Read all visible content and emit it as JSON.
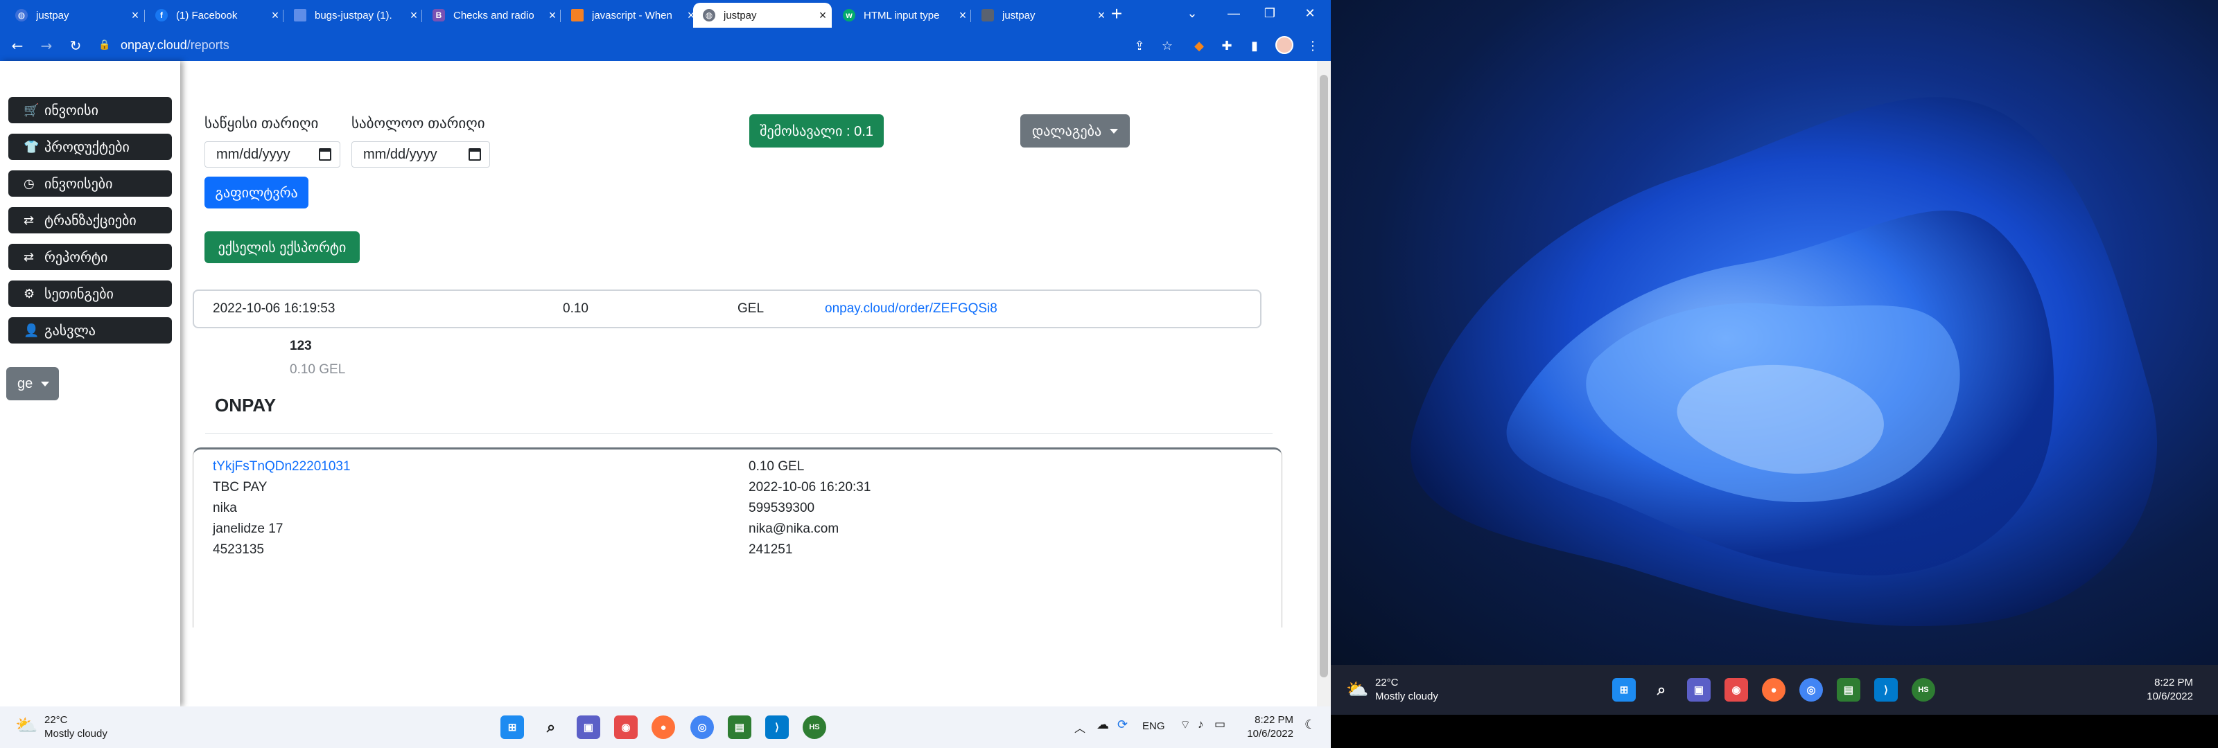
{
  "browser": {
    "tabs": [
      {
        "title": "justpay",
        "favicon": "globe-icon",
        "active": false
      },
      {
        "title": "(1) Facebook",
        "favicon": "facebook-icon",
        "active": false
      },
      {
        "title": "bugs-justpay (1).",
        "favicon": "document-icon",
        "active": false
      },
      {
        "title": "Checks and radio",
        "favicon": "bootstrap-icon",
        "active": false
      },
      {
        "title": "javascript - When",
        "favicon": "stackoverflow-icon",
        "active": false
      },
      {
        "title": "justpay",
        "favicon": "globe-icon",
        "active": true
      },
      {
        "title": "HTML input type",
        "favicon": "w3schools-icon",
        "active": false
      },
      {
        "title": "justpay",
        "favicon": "globe-icon",
        "active": false
      }
    ],
    "url_host": "onpay.cloud",
    "url_path": "/reports",
    "accent": "#0b57d0"
  },
  "sidebar": {
    "items": [
      {
        "label": "ინვოისი",
        "icon": "cart-icon"
      },
      {
        "label": "პროდუქტები",
        "icon": "shirt-icon"
      },
      {
        "label": "ინვოისები",
        "icon": "clock-icon"
      },
      {
        "label": "ტრანზაქციები",
        "icon": "arrows-icon"
      },
      {
        "label": "რეპორტი",
        "icon": "arrows-icon"
      },
      {
        "label": "სეთინგები",
        "icon": "gears-icon"
      },
      {
        "label": "გასვლა",
        "icon": "user-icon"
      }
    ],
    "language": "ge"
  },
  "filters": {
    "start_label": "საწყისი თარიღი",
    "end_label": "საბოლოო თარიღი",
    "start_placeholder": "mm/dd/yyyy",
    "end_placeholder": "mm/dd/yyyy",
    "filter_button": "გაფილტვრა",
    "export_button": "ექსელის ექსპორტი",
    "income_badge": "შემოსავალი : 0.1",
    "sort_button": "დალაგება"
  },
  "order": {
    "date": "2022-10-06 16:19:53",
    "amount": "0.10",
    "currency": "GEL",
    "link": "onpay.cloud/order/ZEFGQSi8",
    "item_name": "123",
    "item_price": "0.10 GEL",
    "merchant": "ONPAY"
  },
  "transaction": {
    "id": "tYkjFsTnQDn22201031",
    "provider": "TBC PAY",
    "name": "nika",
    "address": "janelidze 17",
    "code": "4523135",
    "amount": "0.10 GEL",
    "date": "2022-10-06 16:20:31",
    "phone": "599539300",
    "email": "nika@nika.com",
    "zip": "241251"
  },
  "taskbar_left": {
    "temp": "22°C",
    "weather": "Mostly cloudy",
    "lang": "ENG",
    "time": "8:22 PM",
    "date": "10/6/2022"
  },
  "taskbar_right": {
    "temp": "22°C",
    "weather": "Mostly cloudy",
    "time": "8:22 PM",
    "date": "10/6/2022"
  }
}
